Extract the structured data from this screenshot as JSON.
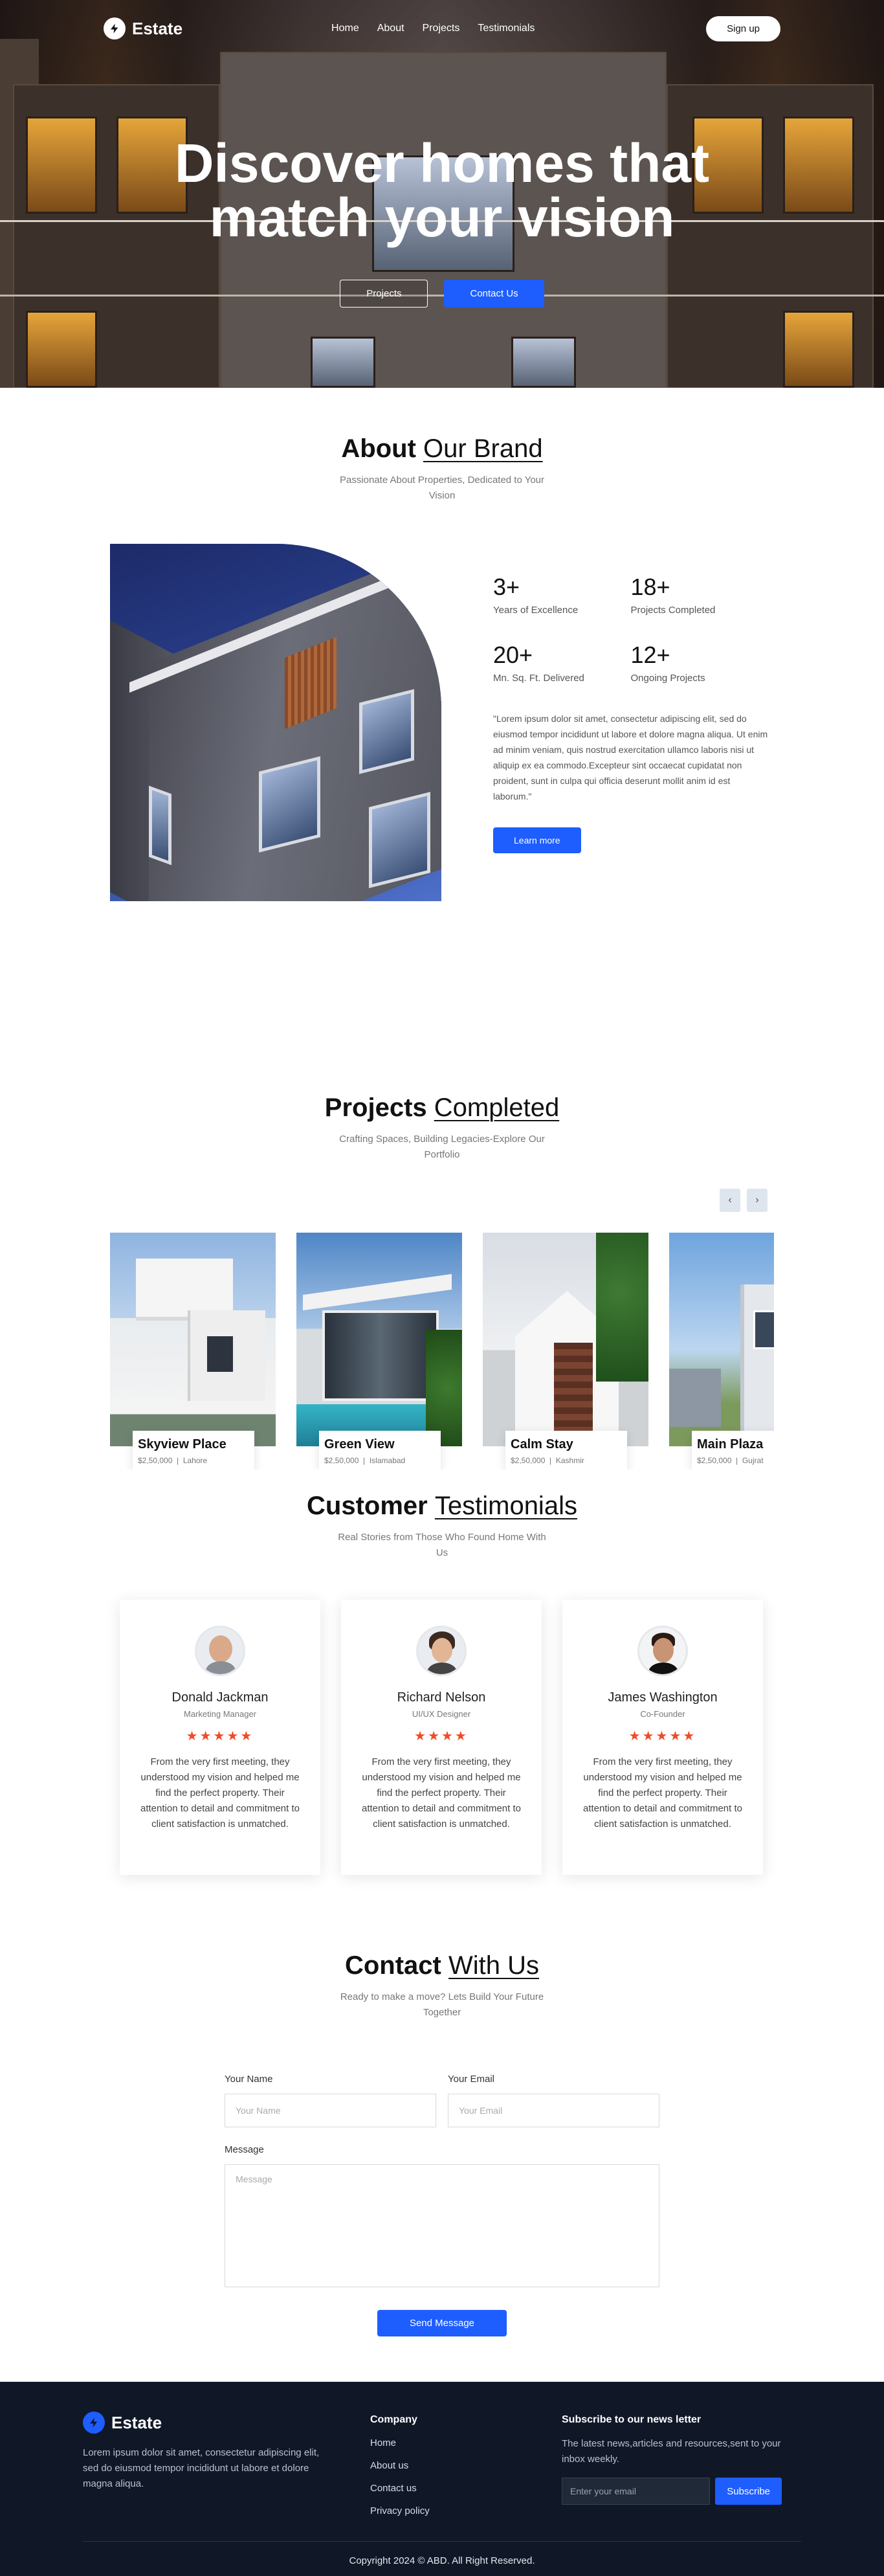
{
  "brand": {
    "name": "Estate"
  },
  "nav": {
    "links": [
      "Home",
      "About",
      "Projects",
      "Testimonials"
    ],
    "signup": "Sign up"
  },
  "hero": {
    "title_line1": "Discover homes that",
    "title_line2": "match your vision",
    "btn_projects": "Projects",
    "btn_contact": "Contact Us"
  },
  "about": {
    "title_bold": "About",
    "title_light": "Our Brand",
    "subtitle": "Passionate About Properties, Dedicated to Your Vision",
    "stats": [
      {
        "num": "3+",
        "label": "Years of Excellence"
      },
      {
        "num": "18+",
        "label": "Projects Completed"
      },
      {
        "num": "20+",
        "label": "Mn. Sq. Ft. Delivered"
      },
      {
        "num": "12+",
        "label": "Ongoing Projects"
      }
    ],
    "quote": "\"Lorem ipsum dolor sit amet, consectetur adipiscing elit, sed do eiusmod tempor incididunt ut labore et dolore magna aliqua. Ut enim ad minim veniam, quis nostrud exercitation ullamco laboris nisi ut aliquip ex ea commodo.Excepteur sint occaecat cupidatat non proident, sunt in culpa qui officia deserunt mollit anim id est laborum.\"",
    "btn": "Learn more"
  },
  "projects": {
    "title_bold": "Projects",
    "title_light": "Completed",
    "subtitle": "Crafting Spaces, Building Legacies-Explore Our Portfolio",
    "items": [
      {
        "name": "Skyview Place",
        "price": "$2,50,000",
        "location": "Lahore"
      },
      {
        "name": "Green View",
        "price": "$2,50,000",
        "location": "Islamabad"
      },
      {
        "name": "Calm Stay",
        "price": "$2,50,000",
        "location": "Kashmir"
      },
      {
        "name": "Main Plaza",
        "price": "$2,50,000",
        "location": "Gujrat"
      }
    ]
  },
  "testimonials": {
    "title_bold": "Customer",
    "title_light": "Testimonials",
    "subtitle": "Real Stories from Those Who Found Home With Us",
    "items": [
      {
        "name": "Donald Jackman",
        "role": "Marketing Manager",
        "stars": "★★★★★",
        "text": "From the very first meeting, they understood my vision and helped me find the perfect property. Their attention to detail and commitment to client satisfaction is unmatched."
      },
      {
        "name": "Richard Nelson",
        "role": "UI/UX Designer",
        "stars": "★★★★",
        "text": "From the very first meeting, they understood my vision and helped me find the perfect property. Their attention to detail and commitment to client satisfaction is unmatched."
      },
      {
        "name": "James Washington",
        "role": "Co-Founder",
        "stars": "★★★★★",
        "text": "From the very first meeting, they understood my vision and helped me find the perfect property. Their attention to detail and commitment to client satisfaction is unmatched."
      }
    ]
  },
  "contact": {
    "title_bold": "Contact",
    "title_light": "With Us",
    "subtitle": "Ready to make a move? Lets Build Your Future Together",
    "name_label": "Your Name",
    "name_placeholder": "Your Name",
    "email_label": "Your Email",
    "email_placeholder": "Your Email",
    "message_label": "Message",
    "message_placeholder": "Message",
    "btn": "Send Message"
  },
  "footer": {
    "brand": "Estate",
    "about": "Lorem ipsum dolor sit amet, consectetur adipiscing elit, sed do eiusmod tempor incididunt ut labore et dolore magna aliqua.",
    "company_title": "Company",
    "company_links": [
      "Home",
      "About us",
      "Contact us",
      "Privacy policy"
    ],
    "newsletter_title": "Subscribe to our news letter",
    "newsletter_text": "The latest news,articles and resources,sent to your inbox weekly.",
    "email_placeholder": "Enter your email",
    "subscribe": "Subscribe",
    "copyright": "Copyright 2024 © ABD. All Right Reserved."
  },
  "colors": {
    "accent": "#1e5eff",
    "footer_bg": "#101828",
    "star": "#ef4b2a"
  }
}
